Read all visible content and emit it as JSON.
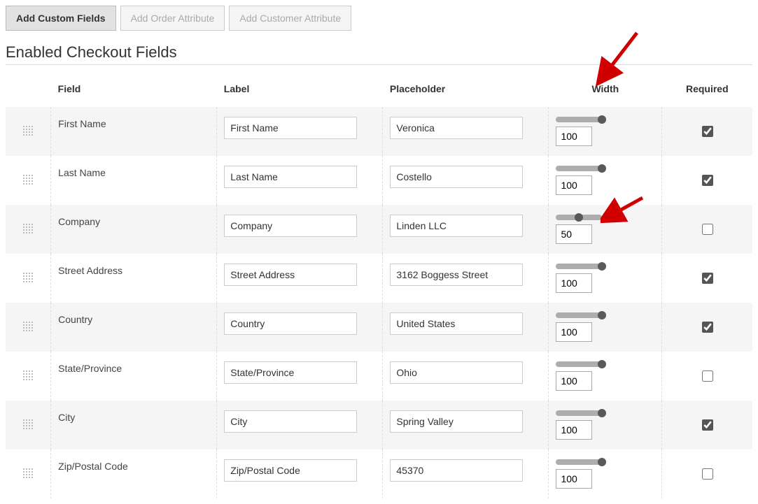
{
  "buttons": {
    "add_custom_fields": "Add Custom Fields",
    "add_order_attribute": "Add Order Attribute",
    "add_customer_attribute": "Add Customer Attribute"
  },
  "section_title": "Enabled Checkout Fields",
  "headers": {
    "field": "Field",
    "label": "Label",
    "placeholder": "Placeholder",
    "width": "Width",
    "required": "Required"
  },
  "rows": [
    {
      "field": "First Name",
      "label": "First Name",
      "placeholder": "Veronica",
      "width": "100",
      "slider_pct": 100,
      "required": true
    },
    {
      "field": "Last Name",
      "label": "Last Name",
      "placeholder": "Costello",
      "width": "100",
      "slider_pct": 100,
      "required": true
    },
    {
      "field": "Company",
      "label": "Company",
      "placeholder": "Linden LLC",
      "width": "50",
      "slider_pct": 50,
      "required": false
    },
    {
      "field": "Street Address",
      "label": "Street Address",
      "placeholder": "3162 Boggess Street",
      "width": "100",
      "slider_pct": 100,
      "required": true
    },
    {
      "field": "Country",
      "label": "Country",
      "placeholder": "United States",
      "width": "100",
      "slider_pct": 100,
      "required": true
    },
    {
      "field": "State/Province",
      "label": "State/Province",
      "placeholder": "Ohio",
      "width": "100",
      "slider_pct": 100,
      "required": false
    },
    {
      "field": "City",
      "label": "City",
      "placeholder": "Spring Valley",
      "width": "100",
      "slider_pct": 100,
      "required": true
    },
    {
      "field": "Zip/Postal Code",
      "label": "Zip/Postal Code",
      "placeholder": "45370",
      "width": "100",
      "slider_pct": 100,
      "required": false
    }
  ]
}
